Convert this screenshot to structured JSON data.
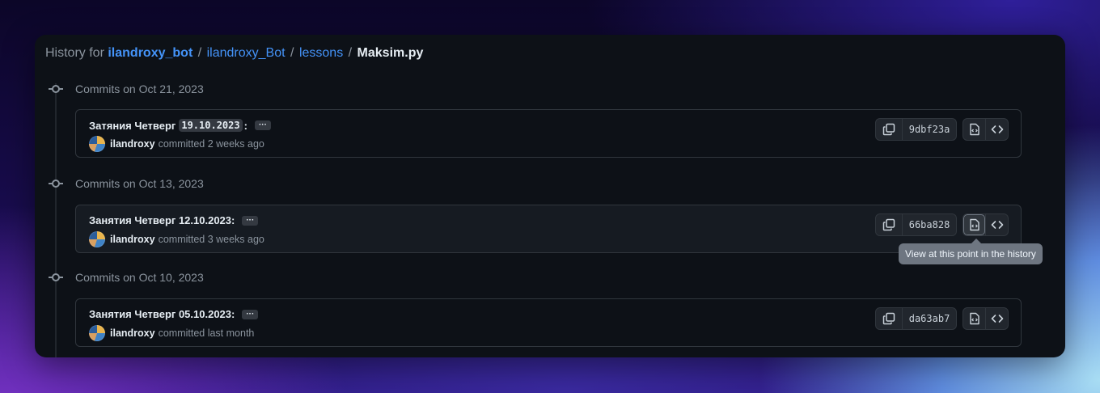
{
  "breadcrumb": {
    "prefix": "History for",
    "repo": "ilandroxy_bot",
    "folder1": "ilandroxy_Bot",
    "folder2": "lessons",
    "file": "Maksim.py",
    "separator": "/"
  },
  "groups": [
    {
      "title": "Commits on Oct 21, 2023",
      "commit": {
        "message_before": "Затяния Четверг",
        "message_code": "19.10.2023",
        "message_after": ":",
        "author": "ilandroxy",
        "time": "committed 2 weeks ago",
        "sha": "9dbf23a"
      }
    },
    {
      "title": "Commits on Oct 13, 2023",
      "commit": {
        "message": "Занятия Четверг 12.10.2023:",
        "author": "ilandroxy",
        "time": "committed 3 weeks ago",
        "sha": "66ba828"
      }
    },
    {
      "title": "Commits on Oct 10, 2023",
      "commit": {
        "message": "Занятия Четверг 05.10.2023:",
        "author": "ilandroxy",
        "time": "committed last month",
        "sha": "da63ab7"
      }
    }
  ],
  "ellipsis": "···",
  "tooltip": "View at this point in the history",
  "icons": {
    "commit": "git-commit-icon",
    "copy": "copy-icon",
    "browse": "file-code-icon",
    "code": "code-icon"
  },
  "colors": {
    "link": "#4493f8",
    "background": "#0d1117",
    "muted": "#8b949e",
    "tooltip": "#6e7681"
  }
}
